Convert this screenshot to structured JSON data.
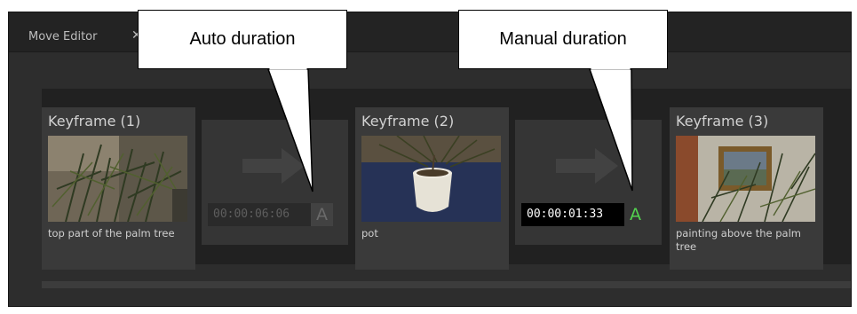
{
  "editor": {
    "tab_label": "Move Editor",
    "tab_close": "✕"
  },
  "keyframes": [
    {
      "title": "Keyframe (1)",
      "caption": "top part of the palm tree"
    },
    {
      "title": "Keyframe (2)",
      "caption": "pot"
    },
    {
      "title": "Keyframe (3)",
      "caption": "painting above the palm tree"
    }
  ],
  "transitions": [
    {
      "duration": "00:00:06:06",
      "mode_label": "A",
      "mode": "auto"
    },
    {
      "duration": "00:00:01:33",
      "mode_label": "A",
      "mode": "manual"
    }
  ],
  "callouts": {
    "auto": "Auto duration",
    "manual": "Manual duration"
  },
  "colors": {
    "manual_mode_accent": "#53d24f",
    "panel_bg": "#2a2a2a"
  },
  "icons": {
    "transition": "arrow-right-icon",
    "close": "close-icon"
  }
}
